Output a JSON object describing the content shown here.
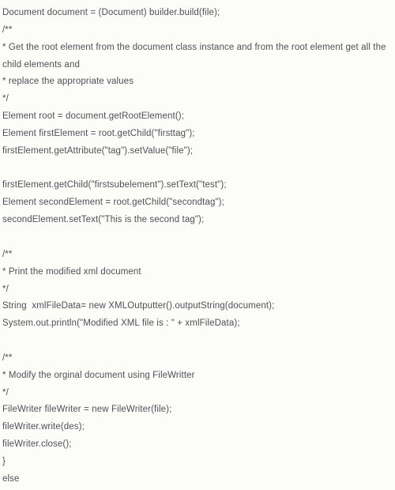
{
  "lines": [
    "Document document = (Document) builder.build(file);",
    "/**",
    "* Get the root element from the document class instance and from the root element get all the child elements and",
    "* replace the appropriate values",
    "*/",
    "Element root = document.getRootElement();",
    "Element firstElement = root.getChild(\"firsttag\");",
    "firstElement.getAttribute(\"tag\").setValue(\"file\");",
    "",
    "firstElement.getChild(\"firstsubelement\").setText(\"test\");",
    "Element secondElement = root.getChild(\"secondtag\");",
    "secondElement.setText(\"This is the second tag\");",
    "",
    "/**",
    "* Print the modified xml document",
    "*/",
    "String  xmlFileData= new XMLOutputter().outputString(document);",
    "System.out.println(\"Modified XML file is : \" + xmlFileData);",
    "",
    "/**",
    "* Modify the orginal document using FileWritter",
    "*/",
    "FileWriter fileWriter = new FileWriter(file);",
    "fileWriter.write(des);",
    "fileWriter.close();",
    "}",
    "else"
  ]
}
